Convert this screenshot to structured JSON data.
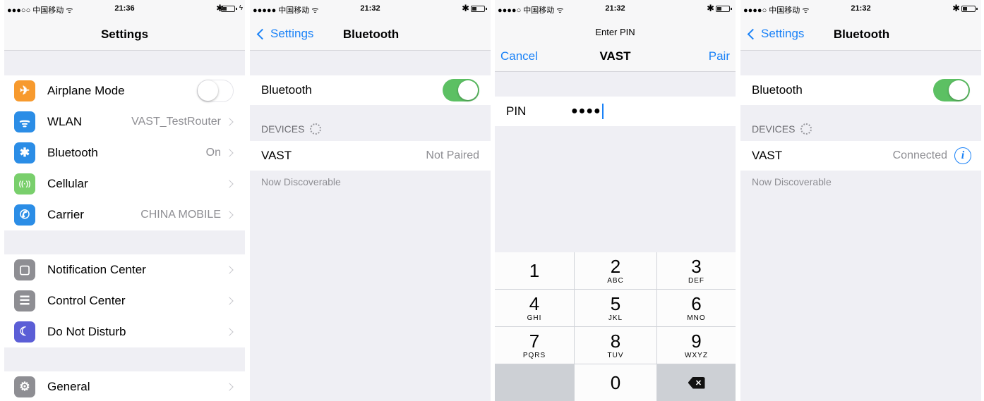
{
  "screens": [
    {
      "status": {
        "carrier": "●●●○○ 中国移动 ᯤ",
        "time": "21:36",
        "bluetooth": "✱",
        "charge": "ϟ"
      },
      "title": "Settings",
      "rows": [
        {
          "icon": "airplane-icon",
          "icon_glyph": "✈",
          "icon_color": "#f79a2e",
          "label": "Airplane Mode",
          "toggle": "off"
        },
        {
          "icon": "wifi-icon",
          "icon_glyph": "ᯤ",
          "icon_color": "#2b8de6",
          "label": "WLAN",
          "value": "VAST_TestRouter"
        },
        {
          "icon": "bluetooth-icon",
          "icon_glyph": "✱",
          "icon_color": "#2b8de6",
          "label": "Bluetooth",
          "value": "On"
        },
        {
          "icon": "cellular-icon",
          "icon_glyph": "((·))",
          "icon_color": "#79cf6c",
          "label": "Cellular",
          "value": ""
        },
        {
          "icon": "carrier-phone-icon",
          "icon_glyph": "✆",
          "icon_color": "#2b8de6",
          "label": "Carrier",
          "value": "CHINA MOBILE"
        },
        {
          "icon": "notification-center-icon",
          "icon_glyph": "▢",
          "icon_color": "#8e8e93",
          "label": "Notification Center",
          "value": ""
        },
        {
          "icon": "control-center-icon",
          "icon_glyph": "☰",
          "icon_color": "#8e8e93",
          "label": "Control Center",
          "value": ""
        },
        {
          "icon": "moon-icon",
          "icon_glyph": "☾",
          "icon_color": "#5b5ed6",
          "label": "Do Not Disturb",
          "value": ""
        },
        {
          "icon": "gear-icon",
          "icon_glyph": "⚙",
          "icon_color": "#8e8e93",
          "label": "General",
          "value": ""
        }
      ]
    },
    {
      "status": {
        "carrier": "●●●●● 中国移动 ᯤ",
        "time": "21:32",
        "bluetooth": "✱"
      },
      "back": "Settings",
      "title": "Bluetooth",
      "bluetooth_label": "Bluetooth",
      "section": "DEVICES",
      "device": {
        "name": "VAST",
        "state": "Not Paired"
      },
      "footer": "Now Discoverable"
    },
    {
      "status": {
        "carrier": "●●●●○ 中国移动 ᯤ",
        "time": "21:32",
        "bluetooth": "✱"
      },
      "prompt": "Enter PIN",
      "cancel": "Cancel",
      "device_name": "VAST",
      "pair": "Pair",
      "pin_label": "PIN",
      "pin_value": "●●●●",
      "keys": [
        {
          "digit": "1",
          "letters": ""
        },
        {
          "digit": "2",
          "letters": "ABC"
        },
        {
          "digit": "3",
          "letters": "DEF"
        },
        {
          "digit": "4",
          "letters": "GHI"
        },
        {
          "digit": "5",
          "letters": "JKL"
        },
        {
          "digit": "6",
          "letters": "MNO"
        },
        {
          "digit": "7",
          "letters": "PQRS"
        },
        {
          "digit": "8",
          "letters": "TUV"
        },
        {
          "digit": "9",
          "letters": "WXYZ"
        },
        {
          "digit": "0",
          "letters": ""
        }
      ],
      "delete_glyph": "✕"
    },
    {
      "status": {
        "carrier": "●●●●○ 中国移动 ᯤ",
        "time": "21:32",
        "bluetooth": "✱"
      },
      "back": "Settings",
      "title": "Bluetooth",
      "bluetooth_label": "Bluetooth",
      "section": "DEVICES",
      "device": {
        "name": "VAST",
        "state": "Connected",
        "info_glyph": "i"
      },
      "footer": "Now Discoverable"
    }
  ],
  "colors": {
    "ios_blue": "#1a82f7",
    "toggle_on": "#5cc063",
    "group_bg": "#efeff4"
  }
}
